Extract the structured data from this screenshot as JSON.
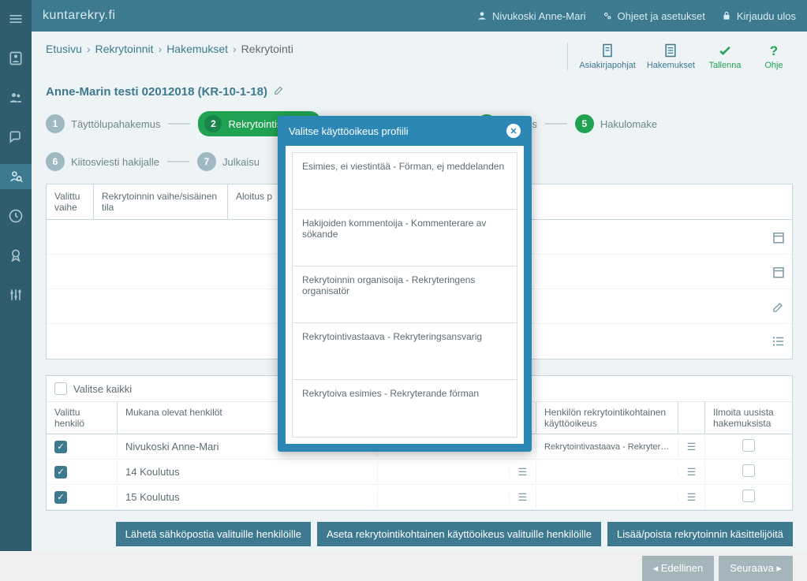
{
  "logo": "kuntarekry.fi",
  "topbar": {
    "user": "Nivukoski Anne-Mari",
    "settings": "Ohjeet ja asetukset",
    "logout": "Kirjaudu ulos"
  },
  "breadcrumb": {
    "items": [
      "Etusivu",
      "Rekrytoinnit",
      "Hakemukset"
    ],
    "current": "Rekrytointi"
  },
  "headerActions": {
    "docs": "Asiakirjapohjat",
    "apps": "Hakemukset",
    "save": "Tallenna",
    "help": "Ohje"
  },
  "title": "Anne-Marin testi 02012018 (KR-10-1-18)",
  "steps": [
    {
      "num": "1",
      "label": "Täyttölupahakemus"
    },
    {
      "num": "2",
      "label": "Rekrytointisuunnit"
    },
    {
      "num": "3",
      "label": "ilmoitus"
    },
    {
      "num": "5",
      "label": "Hakulomake"
    },
    {
      "num": "6",
      "label": "Kiitosviesti hakijalle"
    },
    {
      "num": "7",
      "label": "Julkaisu"
    }
  ],
  "tableHeaders": {
    "valittu": "Valittu vaihe",
    "sisatila": "Rekrytoinnin vaihe/sisäinen tila",
    "aloitus": "Aloitus p"
  },
  "selectAll": "Valitse kaikki",
  "peopleHeaders": {
    "valittu": "Valittu henkilö",
    "mukana": "Mukana olevat henkilöt",
    "oikeus": "Henkilön rekrytointikohtainen käyttöoikeus",
    "ilmoita": "Ilmoita uusista hakemuksista"
  },
  "people": [
    {
      "name": "Nivukoski Anne-Mari",
      "oikeus": "Rekrytointivastaava - Rekryteringsansvarig",
      "checked": true
    },
    {
      "name": "14 Koulutus",
      "oikeus": "",
      "checked": true
    },
    {
      "name": "15 Koulutus",
      "oikeus": "",
      "checked": true
    }
  ],
  "buttons": {
    "email": "Lähetä sähköpostia valituille henkilöille",
    "setRights": "Aseta rekrytointikohtainen käyttöoikeus valituille henkilöille",
    "addRemove": "Lisää/poista rekrytoinnin käsittelijöitä",
    "prev": "Edellinen",
    "next": "Seuraava"
  },
  "modal": {
    "title": "Valitse käyttöoikeus profiili",
    "options": [
      "Esimies, ei viestintää - Förman, ej meddelanden",
      "Hakijoiden kommentoija - Kommenterare av sökande",
      "Rekrytoinnin organisoija - Rekryteringens organisatör",
      "Rekrytointivastaava - Rekryteringsansvarig",
      "Rekrytoiva esimies - Rekryterande förman"
    ]
  }
}
